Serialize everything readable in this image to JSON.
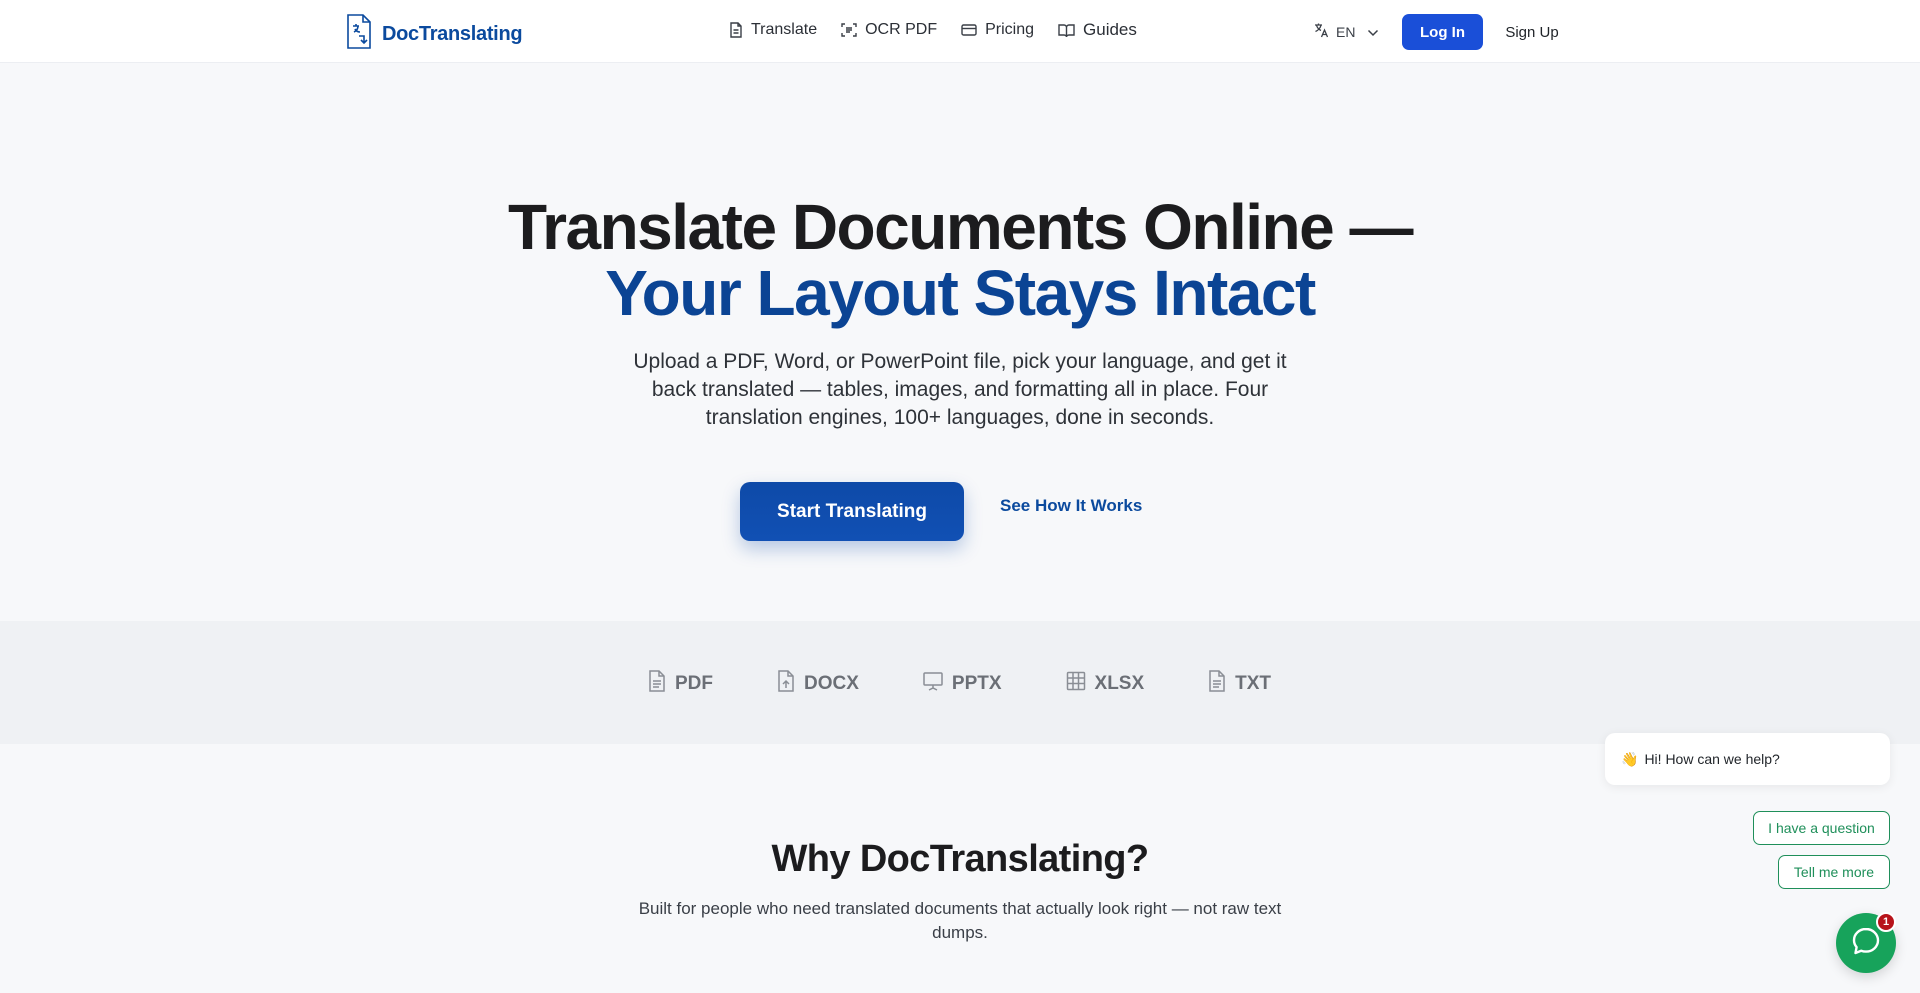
{
  "header": {
    "brand": "DocTranslating",
    "nav": [
      {
        "label": "Translate",
        "icon": "document-icon"
      },
      {
        "label": "OCR PDF",
        "icon": "scan-icon"
      },
      {
        "label": "Pricing",
        "icon": "credit-card-icon"
      },
      {
        "label": "Guides",
        "icon": "book-icon"
      }
    ],
    "language": "EN",
    "login_label": "Log In",
    "signup_label": "Sign Up"
  },
  "hero": {
    "title_line1": "Translate Documents Online —",
    "title_line2": "Your Layout Stays Intact",
    "subtitle": "Upload a PDF, Word, or PowerPoint file, pick your language, and get it back translated — tables, images, and formatting all in place. Four translation engines, 100+ languages, done in seconds.",
    "primary_cta": "Start Translating",
    "secondary_cta": "See How It Works"
  },
  "formats": [
    {
      "label": "PDF",
      "icon": "file-text-icon"
    },
    {
      "label": "DOCX",
      "icon": "file-upload-icon"
    },
    {
      "label": "PPTX",
      "icon": "presentation-icon"
    },
    {
      "label": "XLSX",
      "icon": "table-icon"
    },
    {
      "label": "TXT",
      "icon": "file-text-icon"
    }
  ],
  "why": {
    "title": "Why DocTranslating?",
    "subtitle": "Built for people who need translated documents that actually look right — not raw text dumps."
  },
  "chat": {
    "greeting_emoji": "👋",
    "greeting": "Hi! How can we help?",
    "option_1": "I have a question",
    "option_2": "Tell me more",
    "badge_count": "1",
    "accent_color": "#17a35b"
  },
  "colors": {
    "brand_blue": "#0b4a9e",
    "login_blue": "#1a4fd8",
    "badge_red": "#b7131a"
  }
}
